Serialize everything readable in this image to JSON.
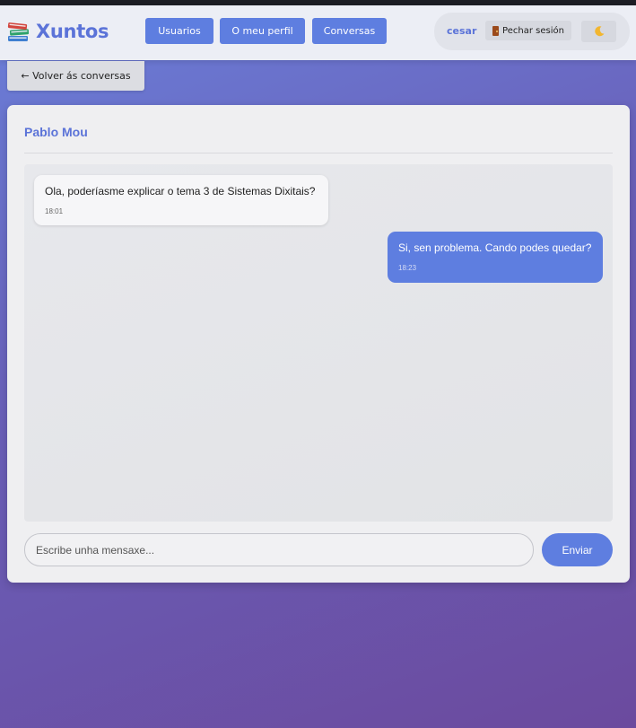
{
  "header": {
    "app_name": "Xuntos",
    "logo_icon": "books-icon",
    "nav": [
      {
        "label": "Usuarios"
      },
      {
        "label": "O meu perfil"
      },
      {
        "label": "Conversas"
      }
    ],
    "user": {
      "name": "cesar",
      "logout_label": "Pechar sesión",
      "logout_icon": "door-icon",
      "theme_icon": "moon-icon"
    }
  },
  "back_label": "← Volver ás conversas",
  "chat": {
    "contact_name": "Pablo Mou",
    "messages": [
      {
        "text": "Ola, poderíasme explicar o tema 3 de Sistemas Dixitais?",
        "time": "18:01",
        "direction": "incoming"
      },
      {
        "text": "Si, sen problema. Cando podes quedar?",
        "time": "18:23",
        "direction": "outgoing"
      }
    ],
    "input": {
      "placeholder": "Escribe unha mensaxe...",
      "value": ""
    },
    "send_label": "Enviar"
  },
  "colors": {
    "accent": "#5e7ee0",
    "brand_text": "#5b73d8",
    "background_start": "#6a7fd9",
    "background_end": "#6b4a9e"
  }
}
